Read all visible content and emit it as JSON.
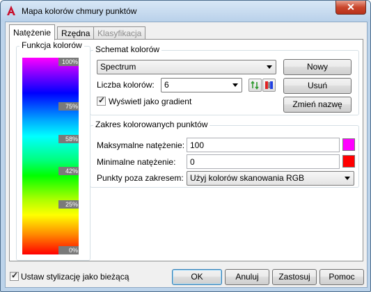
{
  "window": {
    "title": "Mapa kolorów chmury punktów",
    "close_glyph": "✕"
  },
  "tabs": [
    {
      "label": "Natężenie",
      "state": "active"
    },
    {
      "label": "Rzędna",
      "state": "normal"
    },
    {
      "label": "Klasyfikacja",
      "state": "disabled"
    }
  ],
  "color_map": {
    "title": "Funkcja kolorów",
    "labels": [
      "100%",
      "75%",
      "58%",
      "42%",
      "25%",
      "0%"
    ]
  },
  "scheme": {
    "group_title": "Schemat kolorów",
    "selected_scheme": "Spectrum",
    "new_button": "Nowy",
    "count_label": "Liczba kolorów:",
    "count_value": "6",
    "delete_button": "Usuń",
    "gradient_checkbox_label": "Wyświetl jako gradient",
    "gradient_checked": true,
    "rename_button": "Zmień nazwę",
    "icons": [
      "add-color-icon",
      "remove-color-icon"
    ]
  },
  "range": {
    "group_title": "Zakres kolorowanych punktów",
    "max_label": "Maksymalne natężenie:",
    "max_value": "100",
    "max_color": "#ff00ff",
    "min_label": "Minimalne natężenie:",
    "min_value": "0",
    "min_color": "#ff0000",
    "outside_label": "Punkty poza zakresem:",
    "outside_value": "Użyj kolorów skanowania RGB"
  },
  "footer": {
    "current_checkbox_label": "Ustaw stylizację jako bieżącą",
    "current_checked": true,
    "ok": "OK",
    "cancel": "Anuluj",
    "apply": "Zastosuj",
    "help": "Pomoc"
  }
}
